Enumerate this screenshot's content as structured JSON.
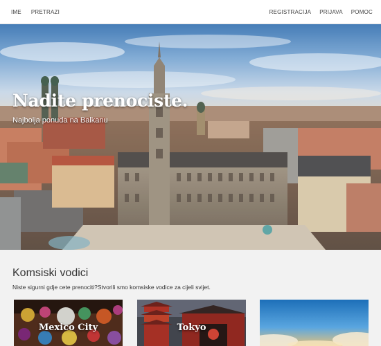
{
  "nav": {
    "left": [
      "IME",
      "PRETRAZI"
    ],
    "right": [
      "REGISTRACIJA",
      "PRIJAVA",
      "POMOC"
    ]
  },
  "hero": {
    "title": "Nadite prenociste.",
    "subtitle": "Najbolja ponuda na Balkanu"
  },
  "guides": {
    "heading": "Komsiski vodici",
    "description": "Niste sigurni gdje cete prenociti?Stvorili smo komsiske vodice za cijeli svijet.",
    "cards": [
      {
        "label": "Mexico City"
      },
      {
        "label": "Tokyo"
      },
      {
        "label": ""
      }
    ]
  },
  "colors": {
    "navbar_bg": "#ffffff",
    "page_bg": "#f2f2f2",
    "text": "#333333"
  }
}
